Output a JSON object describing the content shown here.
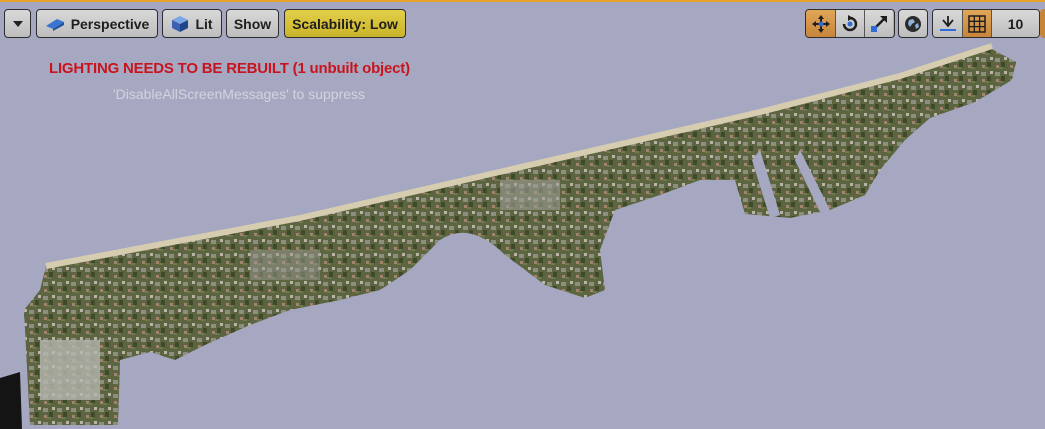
{
  "toolbar": {
    "menu_icon": "chevron-down-icon",
    "perspective_label": "Perspective",
    "lit_label": "Lit",
    "show_label": "Show",
    "scalability_label": "Scalability: Low",
    "transform_tools": [
      "move-icon",
      "rotate-icon",
      "scale-icon"
    ],
    "world_icon": "globe-icon",
    "surface_snap_icon": "surface-snap-icon",
    "grid_icon": "grid-snap-icon",
    "grid_snap_value": "10",
    "accent_color": "#e2a657",
    "scalability_color": "#d9c23a"
  },
  "messages": {
    "lighting_warning": "LIGHTING NEEDS TO BE REBUILT (1 unbuilt object)",
    "suppress_hint": "'DisableAllScreenMessages' to suppress",
    "warning_color": "#c8141c"
  },
  "viewport": {
    "background_color": "#a6a8c2",
    "content": "photogrammetry city model"
  }
}
